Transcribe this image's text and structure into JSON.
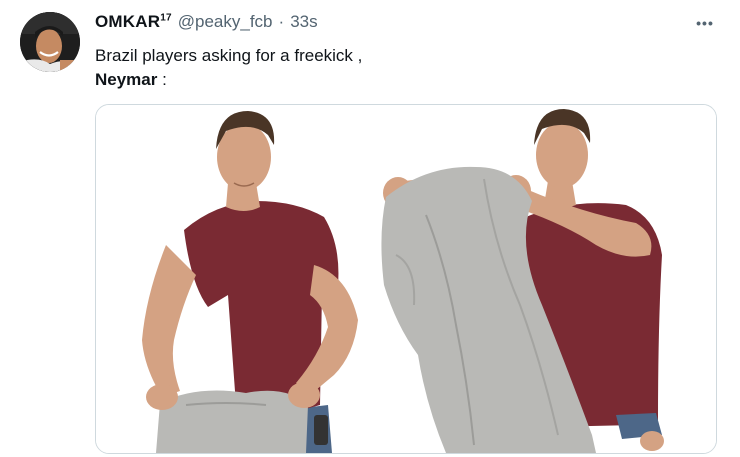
{
  "tweet": {
    "author_name": "OMKAR",
    "author_badge": "17",
    "handle": "@peaky_fcb",
    "separator": "·",
    "timestamp": "33s",
    "more_icon": "more-horizontal-icon",
    "text_line1": "Brazil players asking for a freekick ,",
    "text_line2_bold": "Neymar",
    "text_line2_rest": " :"
  },
  "colors": {
    "shirt": "#7a2a33",
    "jacket": "#b9b9b6",
    "skin": "#d4a283",
    "hair": "#4a3526",
    "secondary_text": "#536471",
    "border": "#cfd9de"
  }
}
